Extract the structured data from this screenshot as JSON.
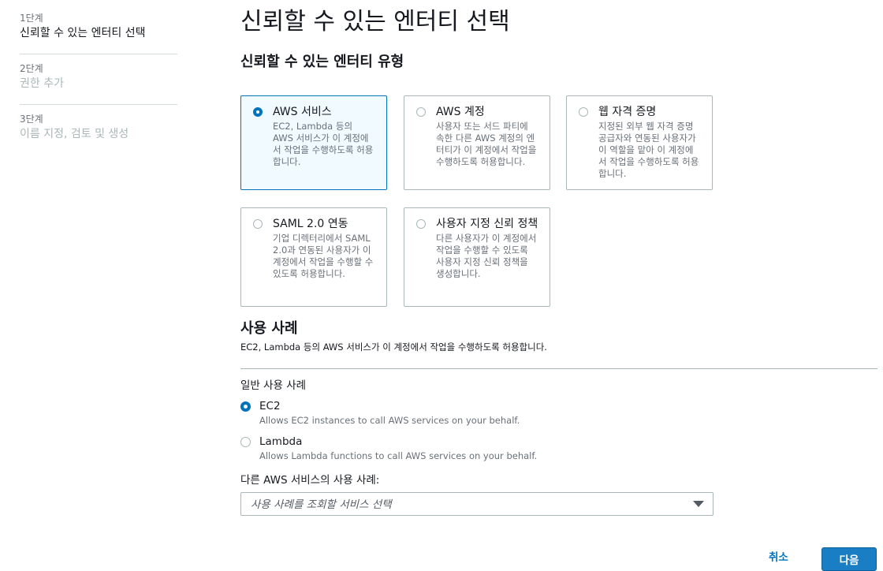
{
  "steps": [
    {
      "num": "1단계",
      "label": "신뢰할 수 있는 엔터티 선택"
    },
    {
      "num": "2단계",
      "label": "권한 추가"
    },
    {
      "num": "3단계",
      "label": "이름 지정, 검토 및 생성"
    }
  ],
  "page_title": "신뢰할 수 있는 엔터티 선택",
  "entity_section_title": "신뢰할 수 있는 엔터티 유형",
  "entity_types": [
    {
      "title": "AWS 서비스",
      "desc": "EC2, Lambda 등의 AWS 서비스가 이 계정에서 작업을 수행하도록 허용합니다.",
      "selected": true
    },
    {
      "title": "AWS 계정",
      "desc": "사용자 또는 서드 파티에 속한 다른 AWS 계정의 엔터티가 이 계정에서 작업을 수행하도록 허용합니다.",
      "selected": false
    },
    {
      "title": "웹 자격 증명",
      "desc": "지정된 외부 웹 자격 증명 공급자와 연동된 사용자가 이 역할을 맡아 이 계정에서 작업을 수행하도록 허용합니다.",
      "selected": false
    },
    {
      "title": "SAML 2.0 연동",
      "desc": "기업 디렉터리에서 SAML 2.0과 연동된 사용자가 이 계정에서 작업을 수행할 수 있도록 허용합니다.",
      "selected": false
    },
    {
      "title": "사용자 지정 신뢰 정책",
      "desc": "다른 사용자가 이 계정에서 작업을 수행할 수 있도록 사용자 지정 신뢰 정책을 생성합니다.",
      "selected": false
    }
  ],
  "use_case": {
    "title": "사용 사례",
    "desc": "EC2, Lambda 등의 AWS 서비스가 이 계정에서 작업을 수행하도록 허용합니다.",
    "common_label": "일반 사용 사례",
    "options": [
      {
        "title": "EC2",
        "desc": "Allows EC2 instances to call AWS services on your behalf.",
        "selected": true
      },
      {
        "title": "Lambda",
        "desc": "Allows Lambda functions to call AWS services on your behalf.",
        "selected": false
      }
    ],
    "other_label": "다른 AWS 서비스의 사용 사례:",
    "select_placeholder": "사용 사례를 조회할 서비스 선택"
  },
  "buttons": {
    "cancel": "취소",
    "next": "다음"
  },
  "colors": {
    "accent": "#0073bb",
    "selected_bg": "#f1faff",
    "primary_button": "#1a7ec4"
  }
}
